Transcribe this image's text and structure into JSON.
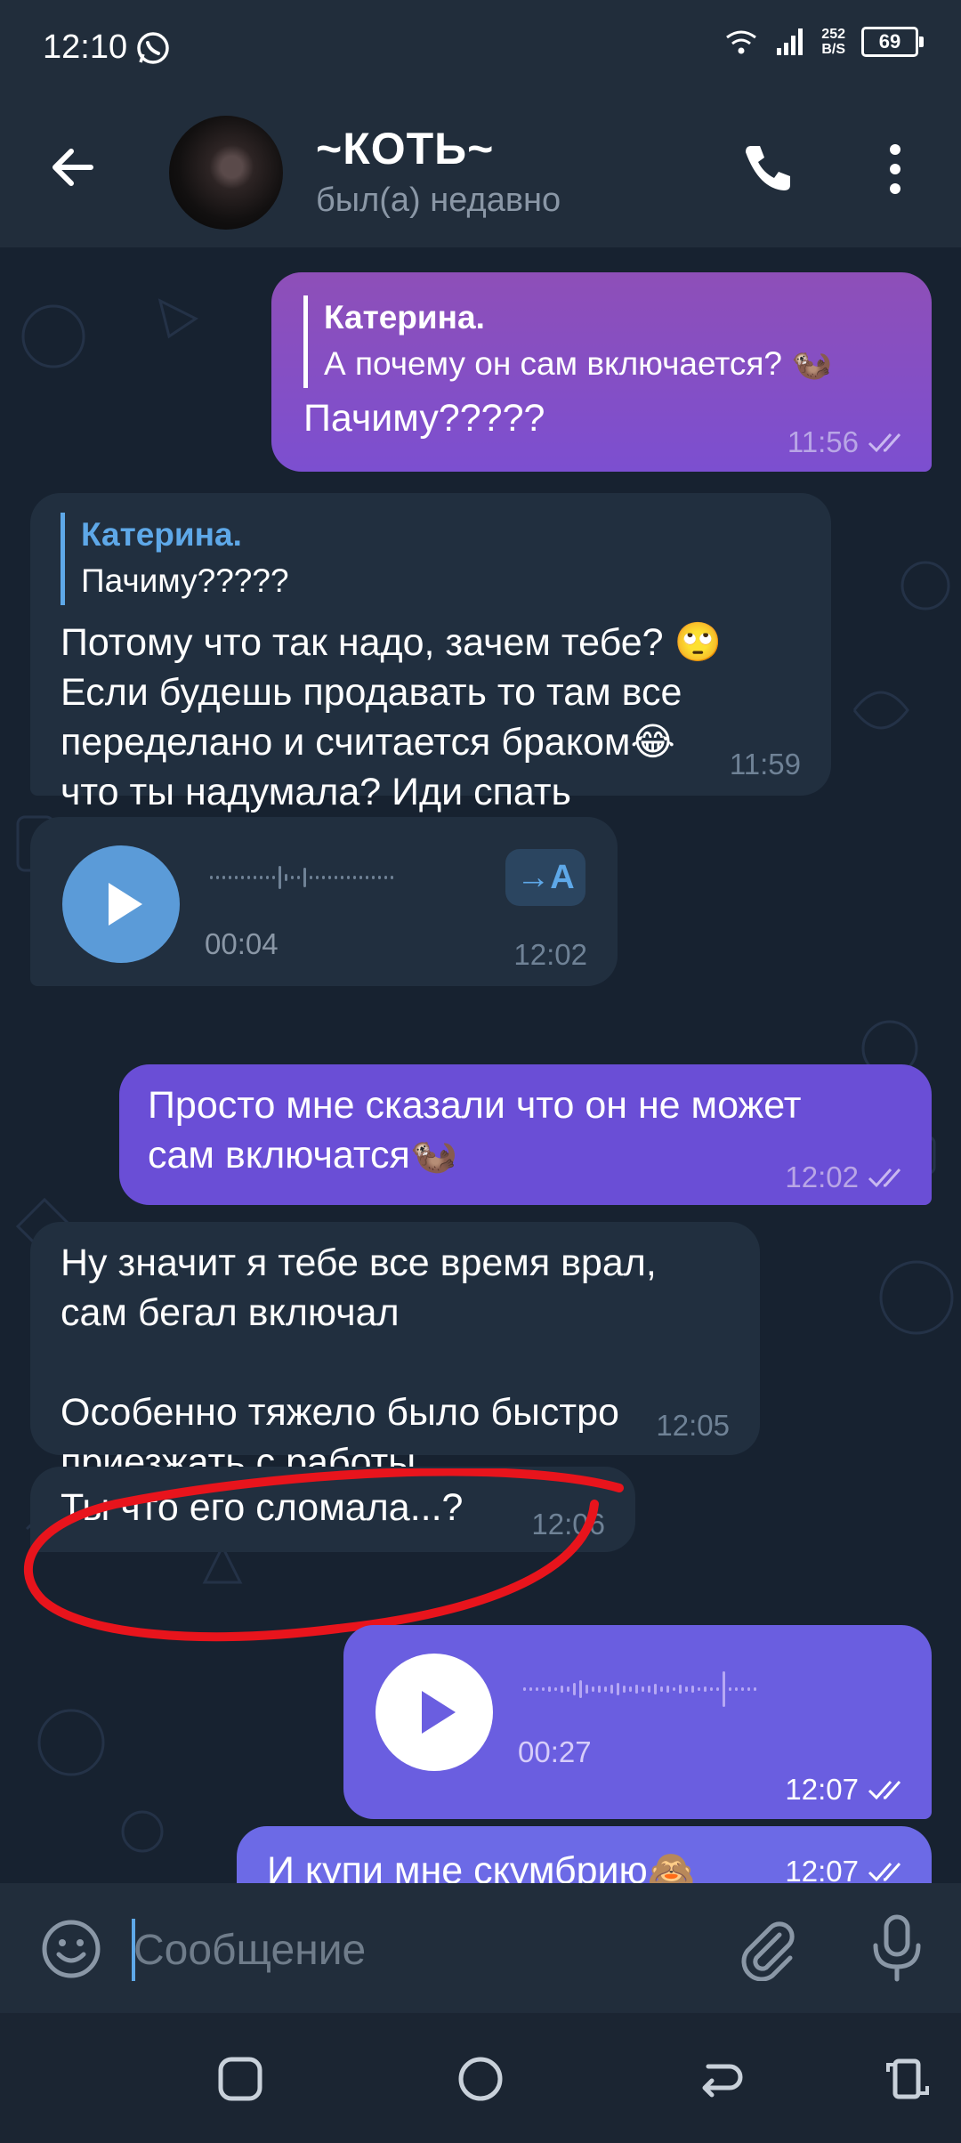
{
  "status_bar": {
    "time": "12:10",
    "net_speed_value": "252",
    "net_speed_unit": "B/S",
    "battery": "69"
  },
  "header": {
    "title": "~КОТЬ~",
    "status": "был(а) недавно"
  },
  "messages": {
    "m1": {
      "reply_name": "Катерина.",
      "reply_text": "А почему он сам включается? 🦦",
      "text": "Пачиму?????",
      "time": "11:56"
    },
    "m2": {
      "reply_name": "Катерина.",
      "reply_text": "Пачиму?????",
      "line1": "Потому что так надо, зачем тебе? 🙄",
      "line2": "Если будешь продавать то там все",
      "line3": "переделано и считается браком😂",
      "line4": "что ты надумала? Иди спать",
      "time": "11:59"
    },
    "m3": {
      "duration": "00:04",
      "transcribe": "→A",
      "time": "12:02"
    },
    "m4": {
      "line1": "Просто мне сказали что он не может",
      "line2": "сам включатся🦦",
      "time": "12:02"
    },
    "m5": {
      "line1": "Ну значит я тебе все время врал,",
      "line2": "сам бегал включал",
      "line3": "Особенно тяжело было быстро",
      "line4": "приезжать  с работы",
      "time": "12:05"
    },
    "m6": {
      "text": "Ты что его сломала...?",
      "time": "12:06"
    },
    "m7": {
      "duration": "00:27",
      "time": "12:07"
    },
    "m8": {
      "text": "И купи мне скумбрию🙈",
      "time": "12:07"
    }
  },
  "input": {
    "placeholder": "Сообщение"
  },
  "colors": {
    "outgoing": "#8e4fb8",
    "incoming": "#212f3f",
    "accent": "#5ea8e8",
    "annotation": "#e8141c"
  },
  "icons": [
    "whatsapp-icon",
    "wifi-icon",
    "signal-icon",
    "back-arrow-icon",
    "phone-icon",
    "more-vert-icon",
    "play-icon",
    "double-check-icon",
    "emoji-icon",
    "attach-icon",
    "mic-icon",
    "recent-apps-icon",
    "home-icon",
    "back-nav-icon",
    "rotate-icon"
  ]
}
